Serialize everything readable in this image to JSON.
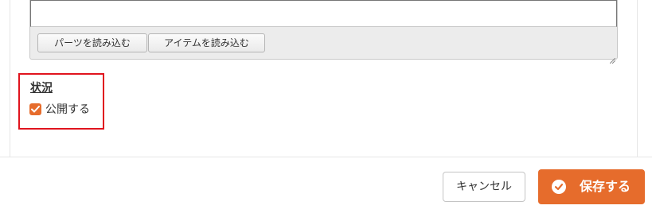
{
  "editor": {
    "content": "",
    "load_parts_label": "パーツを読み込む",
    "load_items_label": "アイテムを読み込む"
  },
  "status": {
    "title": "状況",
    "publish_label": "公開する",
    "publish_checked": true
  },
  "footer": {
    "cancel_label": "キャンセル",
    "save_label": "保存する"
  },
  "colors": {
    "accent": "#e66c2c",
    "highlight_border": "#e0141e"
  },
  "icons": {
    "checkbox": "checkmark-icon",
    "save": "check-circle-icon",
    "resize": "resize-grip-icon"
  }
}
